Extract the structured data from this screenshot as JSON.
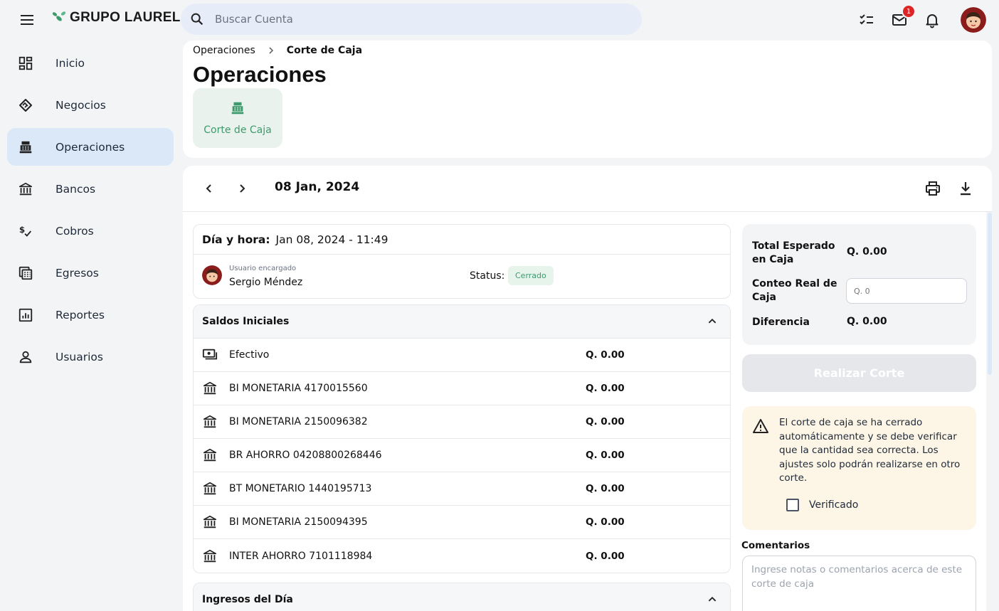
{
  "app": {
    "logo_text": "GRUPO LAUREL",
    "search_placeholder": "Buscar Cuenta",
    "mail_badge": "1"
  },
  "sidebar": {
    "items": [
      {
        "label": "Inicio",
        "icon": "dashboard-icon"
      },
      {
        "label": "Negocios",
        "icon": "handshake-icon"
      },
      {
        "label": "Operaciones",
        "icon": "cash-register-icon",
        "active": true
      },
      {
        "label": "Bancos",
        "icon": "bank-icon"
      },
      {
        "label": "Cobros",
        "icon": "dollar-check-icon"
      },
      {
        "label": "Egresos",
        "icon": "calculator-icon"
      },
      {
        "label": "Reportes",
        "icon": "chart-icon"
      },
      {
        "label": "Usuarios",
        "icon": "user-icon"
      }
    ]
  },
  "header": {
    "breadcrumb": [
      "Operaciones",
      "Corte de Caja"
    ],
    "title": "Operaciones",
    "tile_label": "Corte de Caja"
  },
  "corte": {
    "date": "08 Jan, 2024",
    "datetime_label": "Día y hora:",
    "datetime_value": "Jan 08, 2024 - 11:49",
    "user_caption": "Usuario encargado",
    "user_name": "Sergio Méndez",
    "status_label": "Status:",
    "status_value": "Cerrado"
  },
  "saldos": {
    "title": "Saldos Iniciales",
    "rows": [
      {
        "label": "Efectivo",
        "amount": "Q. 0.00",
        "icon": "cash-icon"
      },
      {
        "label": "BI MONETARIA 4170015560",
        "amount": "Q. 0.00",
        "icon": "bank-icon"
      },
      {
        "label": "BI MONETARIA 2150096382",
        "amount": "Q. 0.00",
        "icon": "bank-icon"
      },
      {
        "label": "BR AHORRO 04208800268446",
        "amount": "Q. 0.00",
        "icon": "bank-icon"
      },
      {
        "label": "BT MONETARIO 1440195713",
        "amount": "Q. 0.00",
        "icon": "bank-icon"
      },
      {
        "label": "BI MONETARIA 2150094395",
        "amount": "Q. 0.00",
        "icon": "bank-icon"
      },
      {
        "label": "INTER AHORRO 7101118984",
        "amount": "Q. 0.00",
        "icon": "bank-icon"
      }
    ]
  },
  "ingresos": {
    "title": "Ingresos del Día"
  },
  "summary": {
    "expected_label": "Total Esperado en Caja",
    "expected_value": "Q. 0.00",
    "count_label": "Conteo Real de Caja",
    "count_placeholder": "Q. 0",
    "diff_label": "Diferencia",
    "diff_value": "Q. 0.00"
  },
  "action": {
    "realizar_label": "Realizar Corte"
  },
  "warning": {
    "text": "El corte de caja se ha cerrado automáticamente y se debe verificar que la cantidad sea correcta. Los ajustes solo podrán realizarse en otro corte.",
    "verify_label": "Verificado"
  },
  "comments": {
    "label": "Comentarios",
    "placeholder": "Ingrese notas o comentarios acerca de este corte de caja"
  },
  "colors": {
    "accent_green": "#3d9a6b",
    "active_nav": "#dbe8f8",
    "badge_red": "#dc2626",
    "warning_bg": "#fdf6e7"
  }
}
